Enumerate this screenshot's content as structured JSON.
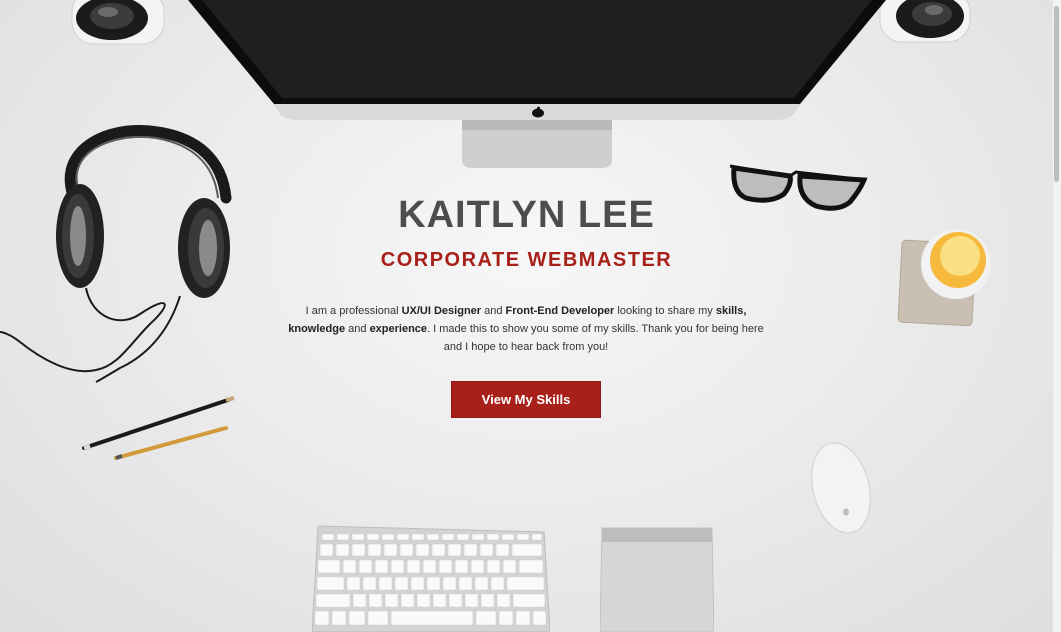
{
  "hero": {
    "name": "KAITLYN LEE",
    "title": "CORPORATE WEBMASTER",
    "intro": {
      "t1": "I am a professional ",
      "b1": "UX/UI Designer",
      "t2": " and ",
      "b2": "Front-End Developer",
      "t3": " looking to share my ",
      "b3": "skills, knowledge",
      "t4": " and ",
      "b4": "experience",
      "t5": ". I made this to show you some of my skills. Thank you for being here and I hope to hear back from you!"
    },
    "cta_label": "View My Skills"
  },
  "colors": {
    "accent": "#a8201a",
    "heading": "#4d4d4d",
    "background": "#ececec"
  },
  "icons": [
    "speaker-icon",
    "monitor-icon",
    "headphones-icon",
    "glasses-icon",
    "juice-glass-icon",
    "coaster-icon",
    "pencil-icon",
    "mouse-icon",
    "keyboard-icon",
    "trackpad-icon",
    "apple-logo-icon"
  ]
}
